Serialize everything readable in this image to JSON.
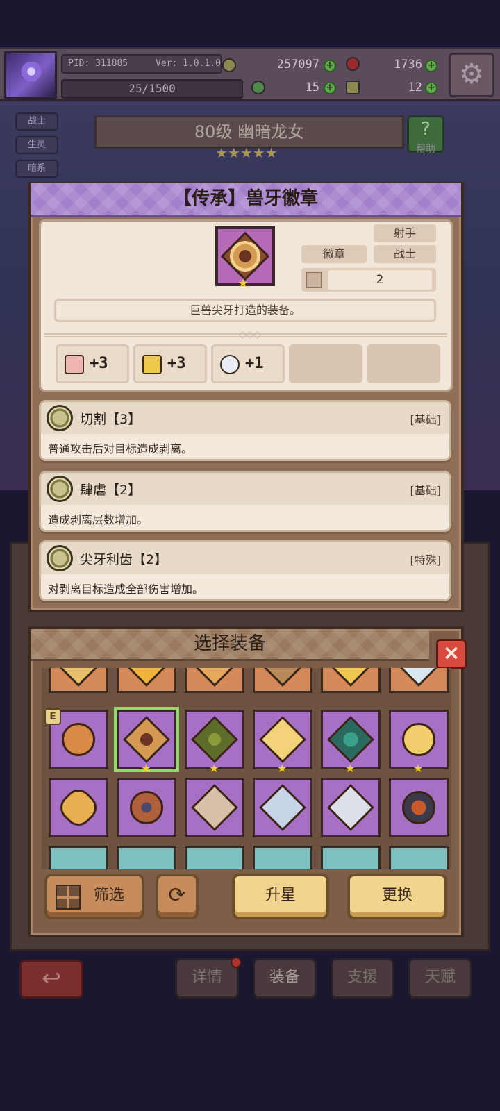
{
  "header": {
    "pid": "PID: 311885",
    "version": "Ver: 1.0.1.0",
    "gold": "257097",
    "gems": "1736",
    "exp": "25/1500",
    "clover": "15",
    "hammer": "12"
  },
  "character": {
    "tags": [
      "战士",
      "生灵",
      "暗系"
    ],
    "name": "80级  幽暗龙女",
    "stars": "★★★★★",
    "help_label": "帮助",
    "help_icon": "?"
  },
  "item_dialog": {
    "title": "【传承】兽牙徽章",
    "star": "★",
    "tags": {
      "type": "徽章",
      "class1": "射手",
      "class2": "战士"
    },
    "slot_value": "2",
    "description": "巨兽尖牙打造的装备。",
    "bonuses": [
      {
        "icon": "strength-icon",
        "value": "+3"
      },
      {
        "icon": "armor-icon",
        "value": "+3"
      },
      {
        "icon": "feather-icon",
        "value": "+1"
      }
    ],
    "skills": [
      {
        "name": "切割【3】",
        "type": "[基础]",
        "desc": "普通攻击后对目标造成剥离。"
      },
      {
        "name": "肆虐【2】",
        "type": "[基础]",
        "desc": "造成剥离层数增加。"
      },
      {
        "name": "尖牙利齿【2】",
        "type": "[特殊]",
        "desc": "对剥离目标造成全部伤害增加。"
      }
    ]
  },
  "selector": {
    "title": "选择装备",
    "close_icon": "×",
    "equipped_badge": "E",
    "filter_label": "筛选",
    "upgrade_label": "升星",
    "replace_label": "更换",
    "refresh_icon": "⟳"
  },
  "bottom_nav": {
    "back_icon": "↩",
    "tabs": [
      "详情",
      "装备",
      "支援",
      "天赋"
    ]
  },
  "colors": {
    "purple_rarity": "#a770c4",
    "orange_rarity": "#d38a58",
    "teal_rarity": "#7cc0c0",
    "selected_outline": "#8fdc6c",
    "close_red": "#d94a3e"
  }
}
